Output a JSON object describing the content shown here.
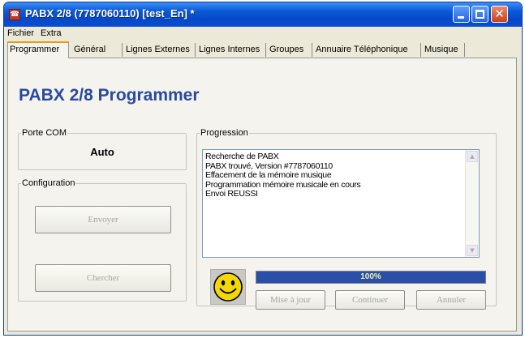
{
  "window": {
    "title": "PABX 2/8 (7787060110) [test_En] *",
    "app_icon": "pabx-app-icon",
    "controls": {
      "minimize": "minimize-icon",
      "maximize": "maximize-icon",
      "close": "close-icon"
    }
  },
  "menu": {
    "items": [
      {
        "label": "Fichier"
      },
      {
        "label": "Extra"
      }
    ]
  },
  "tabs": [
    {
      "label": "Programmer",
      "active": true
    },
    {
      "label": "Général"
    },
    {
      "label": "Lignes Externes"
    },
    {
      "label": "Lignes Internes"
    },
    {
      "label": "Groupes"
    },
    {
      "label": "Annuaire Téléphonique"
    },
    {
      "label": "Musique"
    }
  ],
  "panel": {
    "heading": "PABX 2/8 Programmer",
    "porte_com": {
      "legend": "Porte COM",
      "value": "Auto"
    },
    "configuration": {
      "legend": "Configuration",
      "send_button": "Envoyer",
      "search_button": "Chercher"
    },
    "progression": {
      "legend": "Progression",
      "log": [
        "Recherche de PABX",
        "PABX trouvé, Version #7787060110",
        "Effacement de la mémoire musique",
        "Programmation mémoire musicale en cours",
        "Envoi REUSSI"
      ],
      "status_icon": "smiley-face-icon",
      "progress_percent": 100,
      "progress_text": "100%",
      "buttons": {
        "update": "Mise à jour",
        "continue": "Continuer",
        "cancel": "Annuler"
      }
    }
  },
  "colors": {
    "titlebar": "#0b5bd8",
    "heading": "#2a4aa0",
    "progress_fill": "#2a4fa8",
    "active_tab_accent": "#e89a1a",
    "smiley": "#f5d800"
  }
}
